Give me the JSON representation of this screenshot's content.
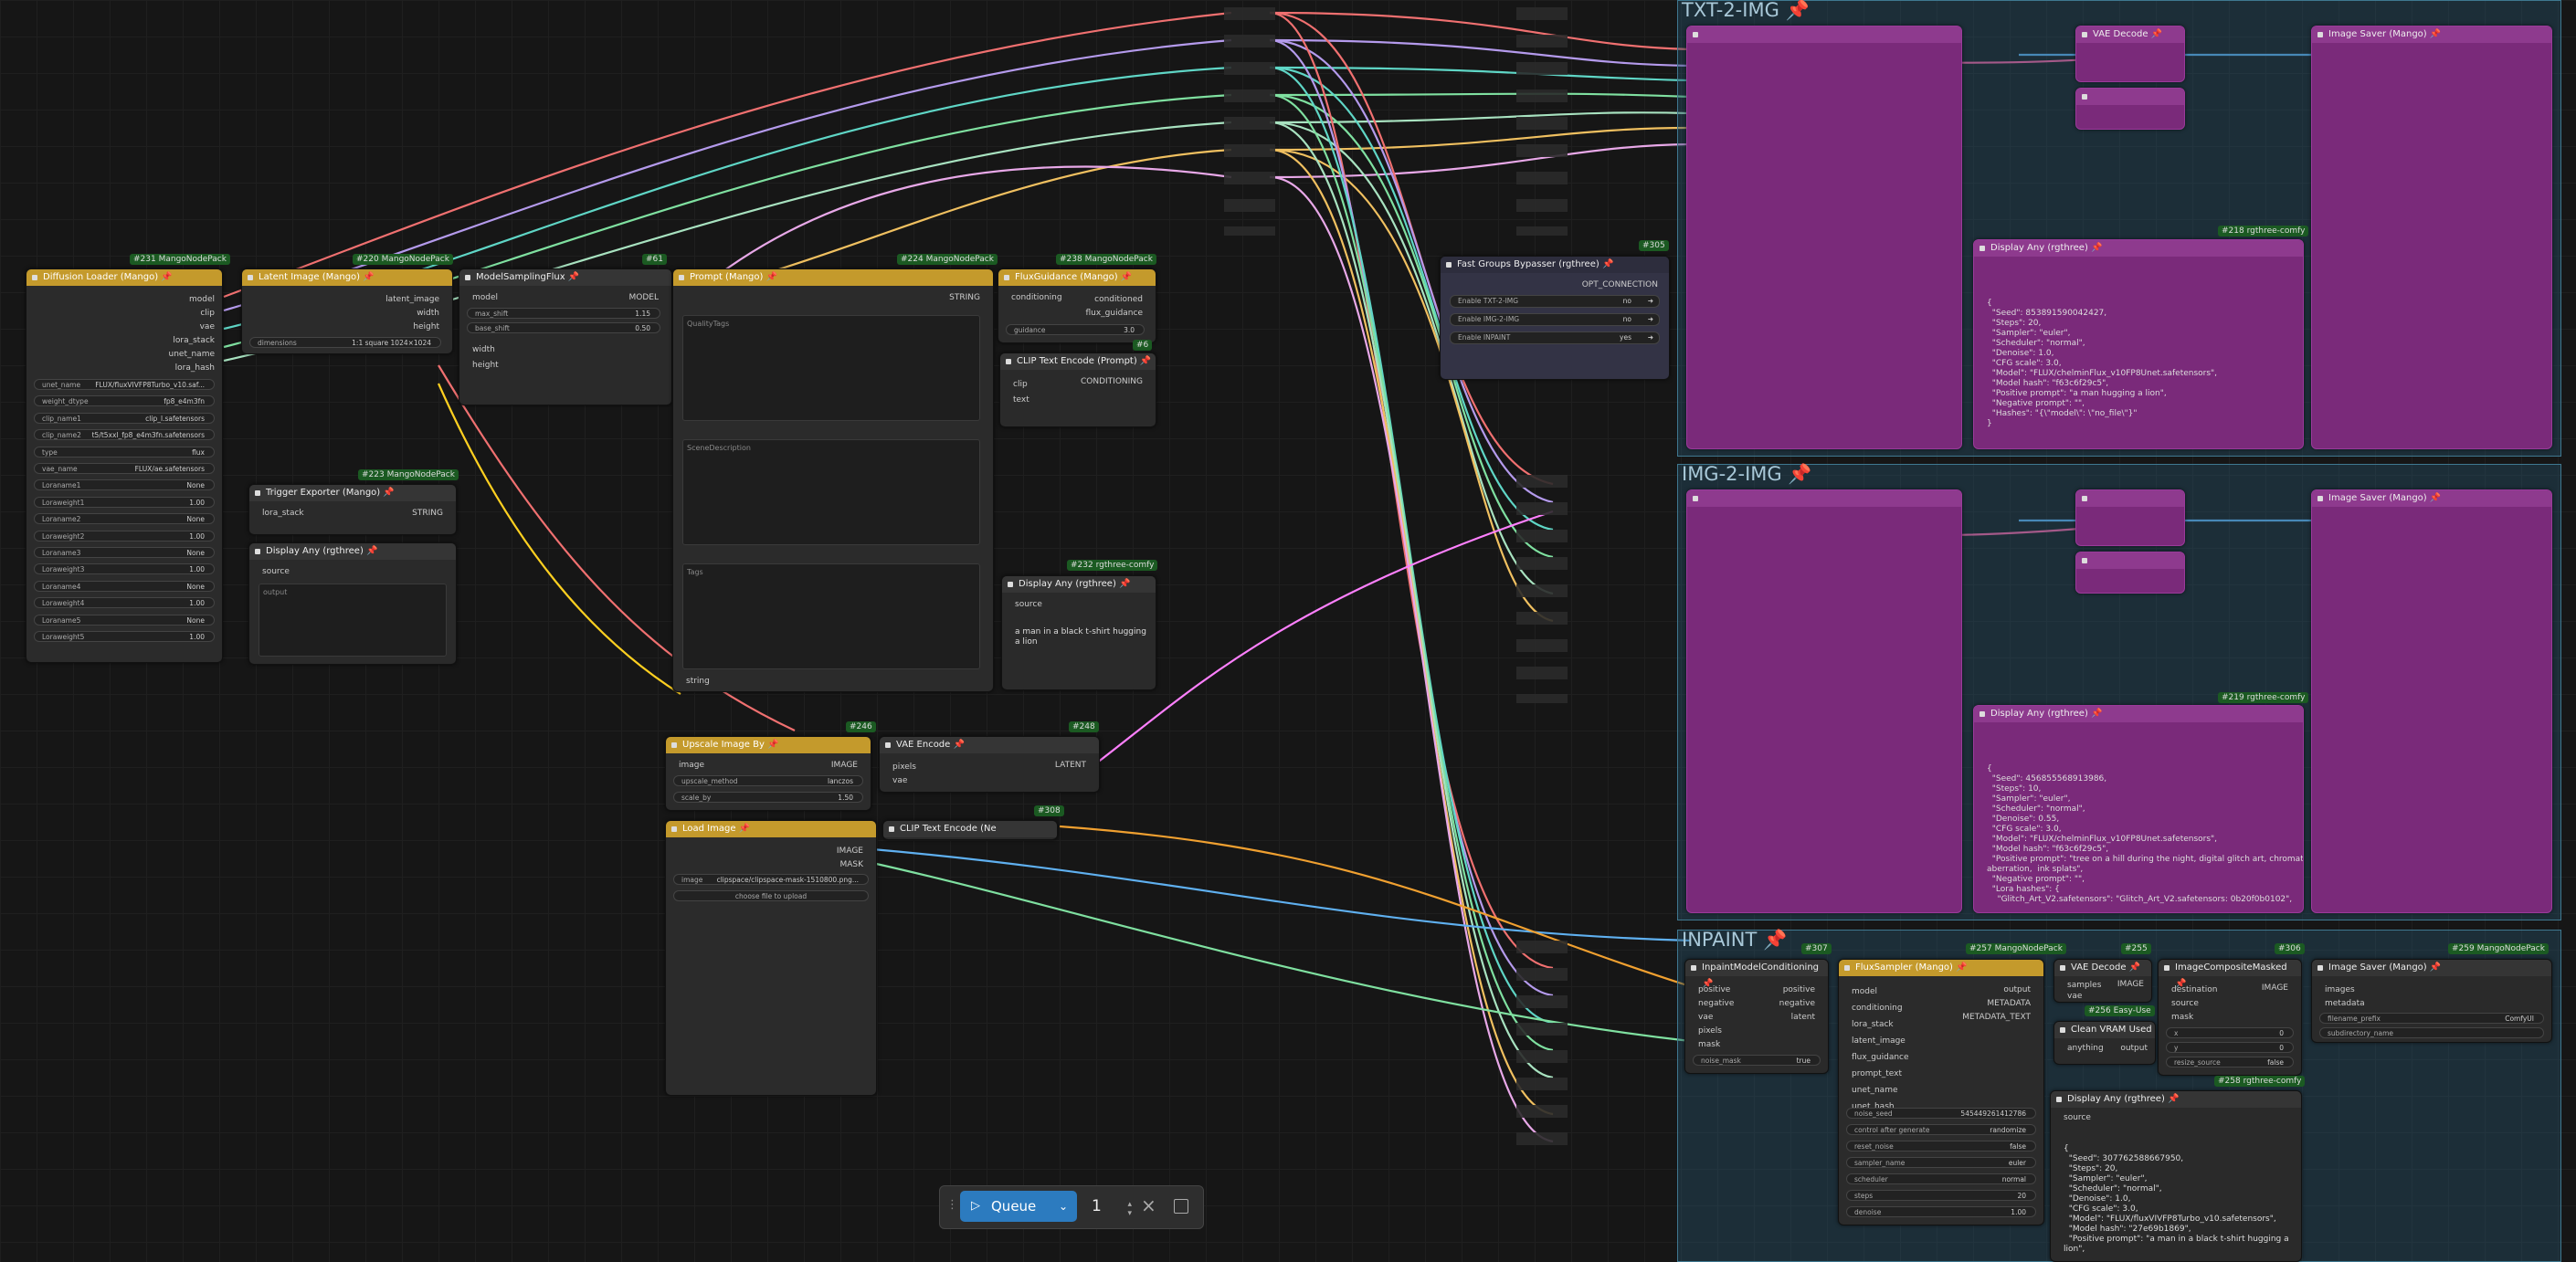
{
  "colors": {
    "accent": "#2c7bbf",
    "mango": "#c49a2c",
    "group": "#265268",
    "purple": "#8e3a8e"
  },
  "groups": {
    "txt2img": "TXT-2-IMG 📌",
    "img2img": "IMG-2-IMG 📌",
    "inpaint": "INPAINT 📌"
  },
  "nodes": {
    "diffusion": {
      "title": "Diffusion Loader (Mango) 📌",
      "tag": "#231 MangoNodePack",
      "outputs": [
        "model",
        "clip",
        "vae",
        "lora_stack",
        "unet_name",
        "lora_hash"
      ],
      "widgets": [
        [
          "unet_name",
          "FLUX/fluxVIVFP8Turbo_v10.saf..."
        ],
        [
          "weight_dtype",
          "fp8_e4m3fn"
        ],
        [
          "clip_name1",
          "clip_l.safetensors"
        ],
        [
          "clip_name2",
          "t5/t5xxl_fp8_e4m3fn.safetensors"
        ],
        [
          "type",
          "flux"
        ],
        [
          "vae_name",
          "FLUX/ae.safetensors"
        ],
        [
          "Loraname1",
          "None"
        ],
        [
          "Loraweight1",
          "1.00"
        ],
        [
          "Loraname2",
          "None"
        ],
        [
          "Loraweight2",
          "1.00"
        ],
        [
          "Loraname3",
          "None"
        ],
        [
          "Loraweight3",
          "1.00"
        ],
        [
          "Loraname4",
          "None"
        ],
        [
          "Loraweight4",
          "1.00"
        ],
        [
          "Loraname5",
          "None"
        ],
        [
          "Loraweight5",
          "1.00"
        ]
      ]
    },
    "latent": {
      "title": "Latent Image (Mango) 📌",
      "tag": "#220 MangoNodePack",
      "outputs": [
        "latent_image",
        "width",
        "height"
      ],
      "widgets": [
        [
          "dimensions",
          "1:1 square 1024×1024"
        ]
      ]
    },
    "msf": {
      "title": "ModelSamplingFlux 📌",
      "tag": "#61",
      "input": "model",
      "output": "MODEL",
      "inputs2": [
        "width",
        "height"
      ],
      "widgets": [
        [
          "max_shift",
          "1.15"
        ],
        [
          "base_shift",
          "0.50"
        ]
      ]
    },
    "prompt": {
      "title": "Prompt (Mango) 📌",
      "tag": "#224 MangoNodePack",
      "output": "STRING",
      "fields": [
        "QualityTags",
        "SceneDescription",
        "Tags"
      ],
      "input": "string"
    },
    "fluxguid": {
      "title": "FluxGuidance (Mango) 📌",
      "tag": "#238 MangoNodePack",
      "input": "conditioning",
      "outputs": [
        "conditioned",
        "flux_guidance"
      ],
      "widgets": [
        [
          "guidance",
          "3.0"
        ]
      ],
      "tag2": "#6"
    },
    "clipenc": {
      "title": "CLIP Text Encode (Prompt) 📌",
      "inputs": [
        "clip",
        "text"
      ],
      "output": "CONDITIONING"
    },
    "trigger": {
      "title": "Trigger Exporter (Mango) 📌",
      "tag": "#223 MangoNodePack",
      "input": "lora_stack",
      "output": "STRING"
    },
    "display1": {
      "title": "Display Any (rgthree) 📌",
      "input": "source",
      "placeholder": "output"
    },
    "display2": {
      "title": "Display Any (rgthree) 📌",
      "tag": "#232 rgthree-comfy",
      "input": "source",
      "text": "a man in a black t-shirt hugging\na lion"
    },
    "upscale": {
      "title": "Upscale Image By 📌",
      "tag": "#246",
      "input": "image",
      "output": "IMAGE",
      "widgets": [
        [
          "upscale_method",
          "lanczos"
        ],
        [
          "scale_by",
          "1.50"
        ]
      ]
    },
    "vaeenc": {
      "title": "VAE Encode 📌",
      "tag": "#248",
      "inputs": [
        "pixels",
        "vae"
      ],
      "output": "LATENT"
    },
    "loadimg": {
      "title": "Load Image 📌",
      "outputs": [
        "IMAGE",
        "MASK"
      ],
      "widgets": [
        [
          "image",
          "clipspace/clipspace-mask-1510800.png..."
        ]
      ],
      "button": "choose file to upload"
    },
    "clip308": {
      "title": "CLIP Text Encode (Ne",
      "tag": "#308"
    },
    "bypasser": {
      "title": "Fast Groups Bypasser (rgthree) 📌",
      "tag": "#305",
      "output": "OPT_CONNECTION",
      "rows": [
        [
          "Enable TXT-2-IMG",
          "no"
        ],
        [
          "Enable IMG-2-IMG",
          "no"
        ],
        [
          "Enable INPAINT",
          "yes"
        ]
      ]
    },
    "t2i_display": {
      "title": "Display Any (rgthree) 📌",
      "tag": "#218 rgthree-comfy",
      "text": "{\n  \"Seed\": 853891590042427,\n  \"Steps\": 20,\n  \"Sampler\": \"euler\",\n  \"Scheduler\": \"normal\",\n  \"Denoise\": 1.0,\n  \"CFG scale\": 3.0,\n  \"Model\": \"FLUX/chelminFlux_v10FP8Unet.safetensors\",\n  \"Model hash\": \"f63c6f29c5\",\n  \"Positive prompt\": \"a man hugging a lion\",\n  \"Negative prompt\": \"\",\n  \"Hashes\": \"{\\\"model\\\": \\\"no_file\\\"}\"\n}"
    },
    "i2i_display": {
      "title": "Display Any (rgthree) 📌",
      "tag": "#219 rgthree-comfy",
      "text": "{\n  \"Seed\": 456855568913986,\n  \"Steps\": 10,\n  \"Sampler\": \"euler\",\n  \"Scheduler\": \"normal\",\n  \"Denoise\": 0.55,\n  \"CFG scale\": 3.0,\n  \"Model\": \"FLUX/chelminFlux_v10FP8Unet.safetensors\",\n  \"Model hash\": \"f63c6f29c5\",\n  \"Positive prompt\": \"tree on a hill during the night, digital glitch art, chromatic\naberration,  ink splats\",\n  \"Negative prompt\": \"\",\n  \"Lora hashes\": {\n    \"Glitch_Art_V2.safetensors\": \"Glitch_Art_V2.safetensors: 0b20f0b0102\","
    },
    "inpaintcond": {
      "title": "InpaintModelConditioning 📌",
      "tag": "#307",
      "inputs": [
        "positive",
        "negative",
        "vae",
        "pixels",
        "mask"
      ],
      "outputs": [
        "positive",
        "negative",
        "latent"
      ],
      "widgets": [
        [
          "noise_mask",
          "true"
        ]
      ]
    },
    "fluxsampler": {
      "title": "FluxSampler (Mango) 📌",
      "tag": "#257 MangoNodePack",
      "inputs": [
        "model",
        "conditioning",
        "lora_stack",
        "latent_image",
        "flux_guidance",
        "prompt_text",
        "unet_name",
        "unet_hash"
      ],
      "outputs": [
        "output",
        "METADATA",
        "METADATA_TEXT"
      ],
      "widgets": [
        [
          "noise_seed",
          "545449261412786"
        ],
        [
          "control after generate",
          "randomize"
        ],
        [
          "reset_noise",
          "false"
        ],
        [
          "sampler_name",
          "euler"
        ],
        [
          "scheduler",
          "normal"
        ],
        [
          "steps",
          "20"
        ],
        [
          "denoise",
          "1.00"
        ]
      ]
    },
    "vaedec": {
      "title": "VAE Decode 📌",
      "tag": "#255",
      "inputs": [
        "samples",
        "vae"
      ],
      "output": "IMAGE"
    },
    "composite": {
      "title": "ImageCompositeMasked 📌",
      "tag": "#306",
      "inputs": [
        "destination",
        "source",
        "mask"
      ],
      "output": "IMAGE",
      "widgets": [
        [
          "x",
          "0"
        ],
        [
          "y",
          "0"
        ],
        [
          "resize_source",
          "false"
        ]
      ]
    },
    "imgsaver": {
      "title": "Image Saver (Mango) 📌",
      "tag": "#259 MangoNodePack",
      "inputs": [
        "images",
        "metadata"
      ],
      "widgets": [
        [
          "filename_prefix",
          "ComfyUI"
        ],
        [
          "subdirectory_name",
          ""
        ]
      ]
    },
    "cleanvram": {
      "title": "Clean VRAM Used",
      "tag": "#256 Easy-Use",
      "input": "anything",
      "output": "output"
    },
    "inp_display": {
      "title": "Display Any (rgthree) 📌",
      "tag": "#258 rgthree-comfy",
      "input": "source",
      "text": "{\n  \"Seed\": 307762588667950,\n  \"Steps\": 20,\n  \"Sampler\": \"euler\",\n  \"Scheduler\": \"normal\",\n  \"Denoise\": 1.0,\n  \"CFG scale\": 3.0,\n  \"Model\": \"FLUX/fluxVIVFP8Turbo_v10.safetensors\",\n  \"Model hash\": \"27e69b1869\",\n  \"Positive prompt\": \"a man in a black t-shirt hugging a\nlion\","
    },
    "t2i_vaedec": {
      "title": "VAE Decode 📌"
    },
    "t2i_saver": {
      "title": "Image Saver (Mango) 📌"
    },
    "i2i_saver": {
      "title": "Image Saver (Mango) 📌"
    }
  },
  "toolbar": {
    "queue": "Queue",
    "count": "1"
  }
}
